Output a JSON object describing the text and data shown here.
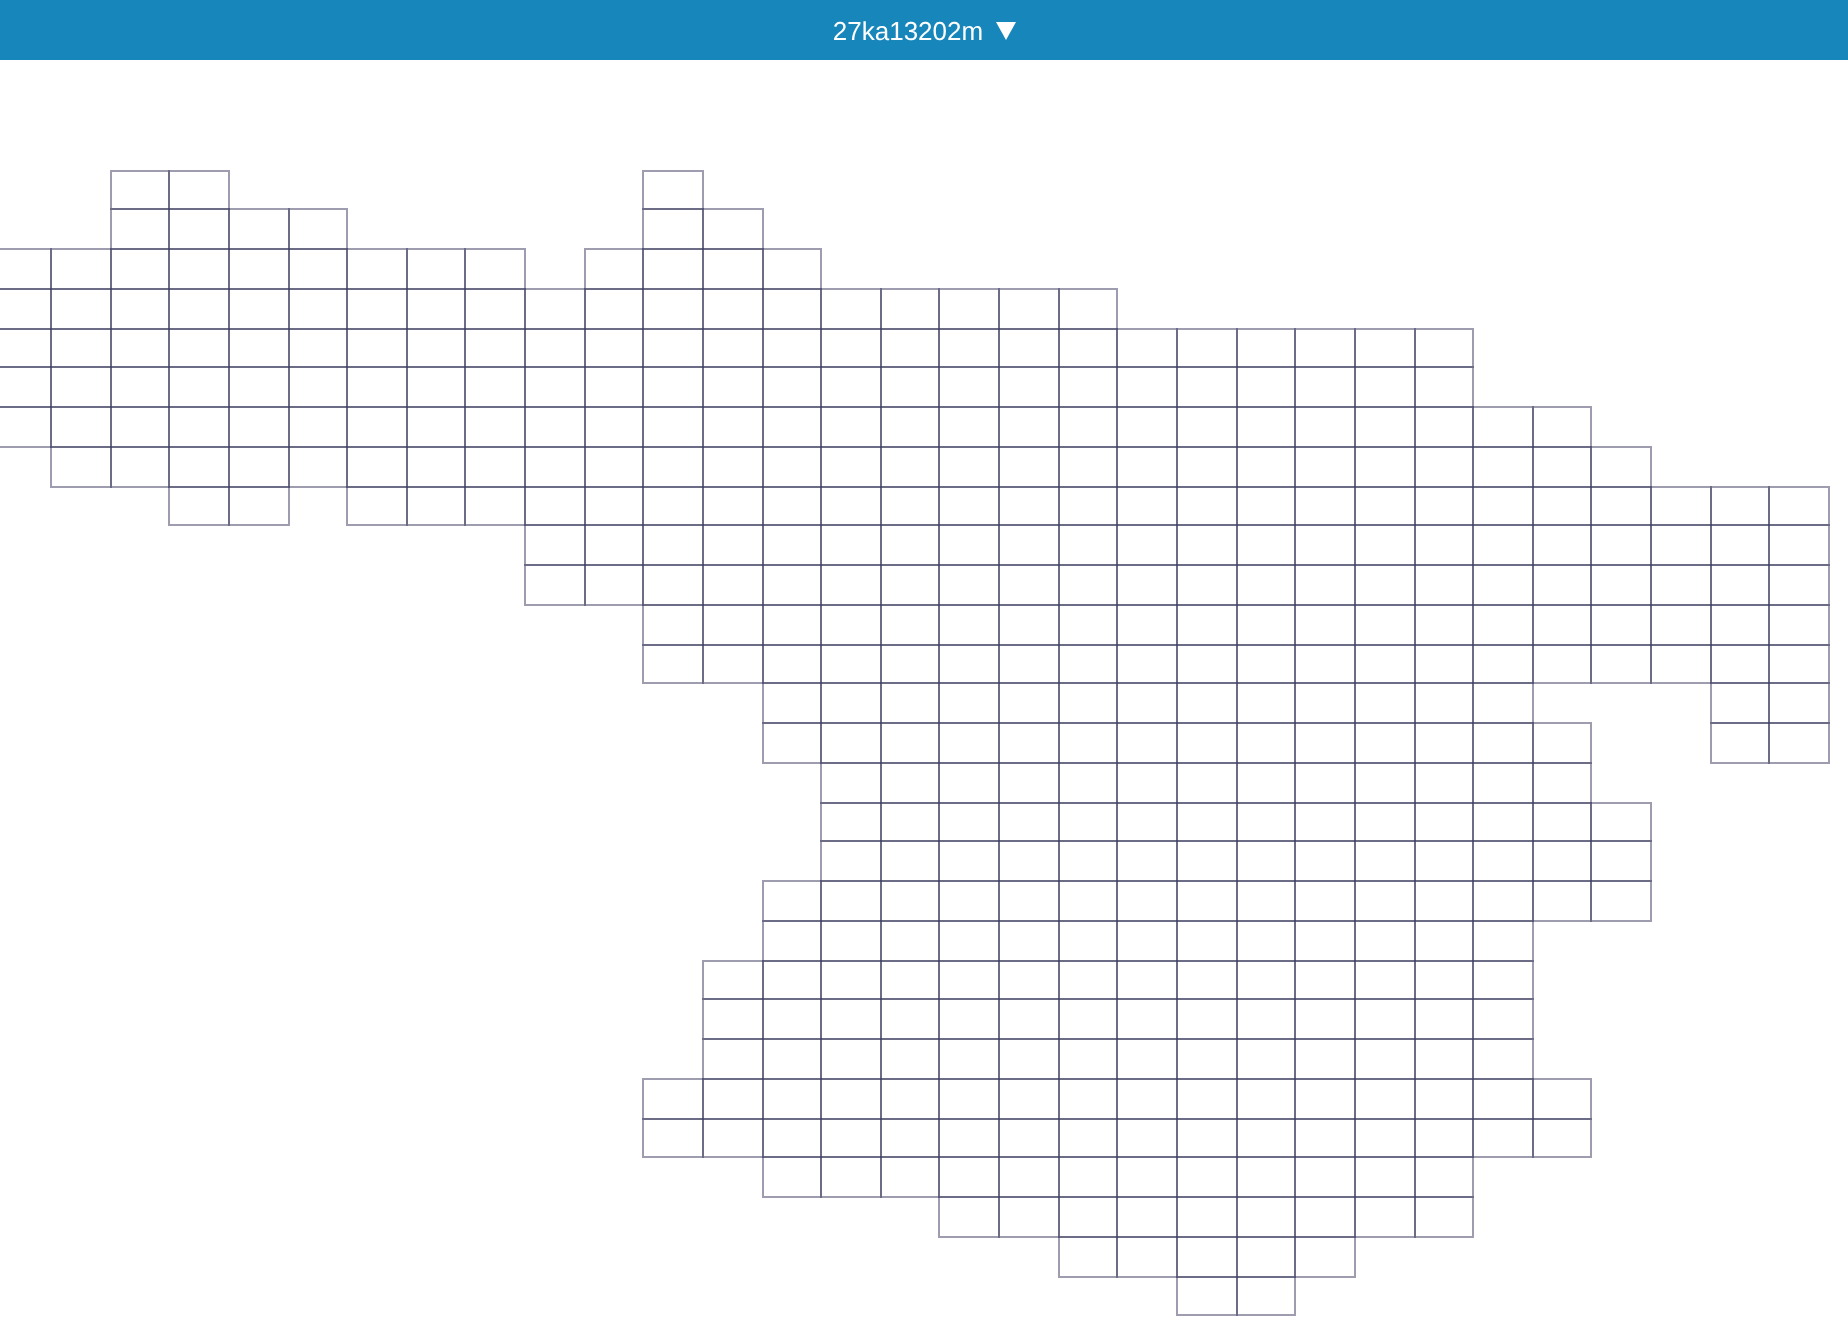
{
  "header": {
    "mesh_selector": {
      "label": "27ka13202m"
    }
  }
}
